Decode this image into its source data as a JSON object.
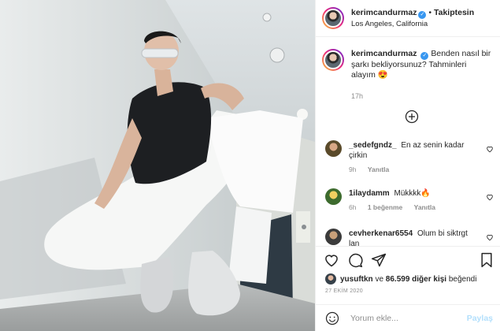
{
  "post": {
    "username": "kerimcandurmaz",
    "follow_label": "Takiptesin",
    "location": "Los Angeles, California",
    "caption_text": "Benden nasıl bir şarkı bekliyorsunuz? Tahminleri alayım 😍",
    "caption_time": "17h"
  },
  "comments": [
    {
      "username": "_sedefgndz_",
      "text": "En az senin kadar çirkin",
      "time": "9h",
      "reply_label": "Yanıtla"
    },
    {
      "username": "1ilaydamm",
      "text": "Mükkkk🔥",
      "time": "6h",
      "likes_label": "1 beğenme",
      "reply_label": "Yanıtla"
    },
    {
      "username": "cevherkenar6554",
      "text": "Olum bi siktrgt lan"
    }
  ],
  "footer": {
    "liked_user": "yusuftkn",
    "liked_joiner": "ve",
    "liked_others": "86.599 diğer kişi",
    "liked_suffix": "beğendi",
    "date": "27 EKİM 2020",
    "comment_placeholder": "Yorum ekle...",
    "share_label": "Paylaş"
  },
  "icons": {
    "verified": "verified-badge-icon",
    "load_more": "plus-circle-icon",
    "like": "heart-icon",
    "comment": "comment-bubble-icon",
    "share": "paper-plane-icon",
    "save": "bookmark-icon",
    "emoji": "smiley-icon"
  },
  "colors": {
    "accent": "#3897f0",
    "share_disabled": "#b2dffc",
    "muted": "#8e8e8e"
  }
}
